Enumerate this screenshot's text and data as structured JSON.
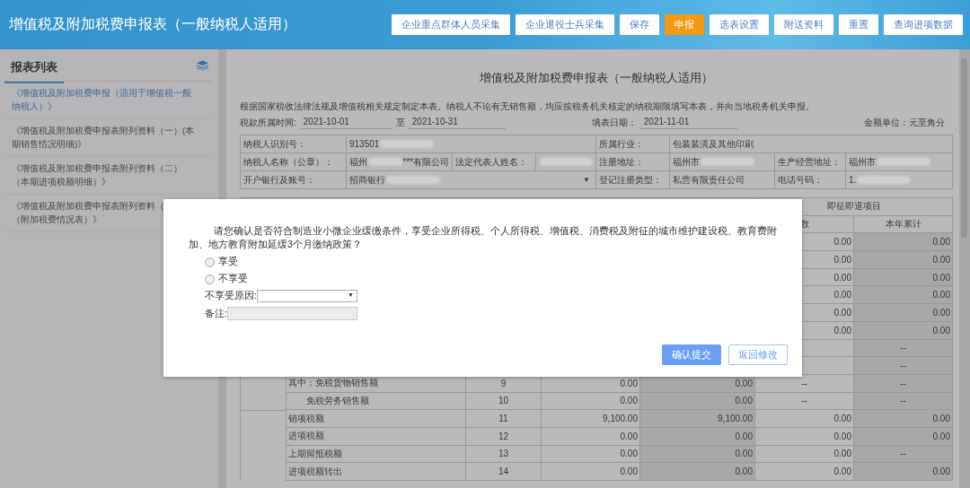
{
  "header": {
    "title": "增值税及附加税费申报表（一般纳税人适用）",
    "buttons": [
      {
        "label": "企业重点群体人员采集",
        "selected": false
      },
      {
        "label": "企业退役士兵采集",
        "selected": false
      },
      {
        "label": "保存",
        "selected": false
      },
      {
        "label": "申报",
        "selected": true
      },
      {
        "label": "选表设置",
        "selected": false
      },
      {
        "label": "附送资料",
        "selected": false
      },
      {
        "label": "重置",
        "selected": false
      },
      {
        "label": "查询进项数据",
        "selected": false
      }
    ]
  },
  "sidebar": {
    "title": "报表列表",
    "items": [
      {
        "lines": [
          "《增值税及附加税费申报（适用于增值税一般",
          "纳税人）》"
        ],
        "selected": true
      },
      {
        "lines": [
          "《增值税及附加税费申报表附列资料（一）(本",
          "期销售情况明细)》"
        ],
        "selected": false
      },
      {
        "lines": [
          "《增值税及附加税费申报表附列资料（二）",
          "（本期进项税额明细）》"
        ],
        "selected": false
      },
      {
        "lines": [
          "《增值税及附加税费申报表附列资料（",
          "（附加税费情况表）》"
        ],
        "selected": false
      }
    ]
  },
  "form": {
    "title": "增值税及附加税费申报表（一般纳税人适用）",
    "note": "根据国家税收法律法规及增值税相关规定制定本表。纳税人不论有无销售额，均应按税务机关核定的纳税期限填写本表，并向当地税务机关申报。",
    "period_label": "税款所属时间:",
    "period_start": "2021-10-01",
    "period_to": "至",
    "period_end": "2021-10-31",
    "fill_date_label": "填表日期：",
    "fill_date": "2021-11-01",
    "unit": "金额单位：元至角分",
    "info_rows": [
      [
        {
          "kind": "label",
          "text": "纳税人识别号："
        },
        {
          "kind": "value",
          "parts": [
            {
              "kind": "text",
              "text": "913501"
            },
            {
              "kind": "blur"
            }
          ]
        },
        {
          "kind": "label",
          "text": "所属行业："
        },
        {
          "kind": "value",
          "parts": [
            {
              "kind": "text",
              "text": "包装装潢及其他印刷"
            }
          ]
        }
      ],
      [
        {
          "kind": "label",
          "text": "纳税人名称（公章）："
        },
        {
          "kind": "value",
          "parts": [
            {
              "kind": "text",
              "text": "福州"
            },
            {
              "kind": "blur"
            },
            {
              "kind": "text",
              "text": "***有限公司"
            }
          ]
        },
        {
          "kind": "label",
          "text": "法定代表人姓名："
        },
        {
          "kind": "value",
          "parts": [
            {
              "kind": "blur"
            }
          ]
        },
        {
          "kind": "label",
          "text": "注册地址："
        },
        {
          "kind": "value",
          "parts": [
            {
              "kind": "text",
              "text": "福州市"
            },
            {
              "kind": "blur"
            }
          ]
        },
        {
          "kind": "label",
          "text": "生产经营地址："
        },
        {
          "kind": "value",
          "parts": [
            {
              "kind": "text",
              "text": "福州市"
            },
            {
              "kind": "blur"
            }
          ]
        }
      ],
      [
        {
          "kind": "label",
          "text": "开户银行及账号："
        },
        {
          "kind": "select",
          "parts": [
            {
              "kind": "text",
              "text": "招商银行"
            },
            {
              "kind": "blur"
            }
          ],
          "arrow": "▼"
        },
        {
          "kind": "label",
          "text": "登记注册类型："
        },
        {
          "kind": "value",
          "parts": [
            {
              "kind": "text",
              "text": "私营有限责任公司"
            }
          ]
        },
        {
          "kind": "label",
          "text": "电话号码："
        },
        {
          "kind": "value",
          "parts": [
            {
              "kind": "text",
              "text": "1."
            },
            {
              "kind": "blur"
            }
          ]
        }
      ]
    ],
    "table": {
      "group_header": "即征即退项目",
      "columns": [
        "数",
        "本年累计"
      ],
      "rows": [
        {
          "c3": "0.00",
          "c4": "0.00"
        },
        {
          "c3": "0.00",
          "c4": "0.00"
        },
        {
          "c3": "0.00",
          "c4": "0.00"
        },
        {
          "c3": "0.00",
          "c4": "0.00"
        },
        {
          "c3": "0.00",
          "c4": "0.00"
        },
        {
          "c3": "0.00",
          "c4": "0.00"
        },
        {
          "c4": "--"
        },
        {
          "c4": "--"
        },
        {
          "item": "其中：免税货物销售额",
          "kind": "main",
          "line": "9",
          "c1": "0.00",
          "c2": "0.00",
          "c3": "--",
          "c4": "--"
        },
        {
          "item": "免税劳务销售额",
          "kind": "sub",
          "line": "10",
          "c1": "0.00",
          "c2": "0.00",
          "c3": "--",
          "c4": "--"
        },
        {
          "item": "销项税额",
          "kind": "main",
          "line": "11",
          "c1": "9,100.00",
          "c2": "9,100.00",
          "c3": "0.00",
          "c4": "0.00"
        },
        {
          "item": "进项税额",
          "kind": "main",
          "line": "12",
          "c1": "0.00",
          "c2": "0.00",
          "c3": "0.00",
          "c4": "0.00"
        },
        {
          "item": "上期留抵税额",
          "kind": "main",
          "line": "13",
          "c1": "0.00",
          "c2": "0.00",
          "c3": "0.00",
          "c4": "--"
        },
        {
          "item": "进项税额转出",
          "kind": "main",
          "line": "14",
          "c1": "0.00",
          "c2": "0.00",
          "c3": "0.00",
          "c4": "0.00"
        }
      ]
    }
  },
  "dialog": {
    "question": "请您确认是否符合制造业小微企业缓缴条件，享受企业所得税、个人所得税、增值税、消费税及附征的城市维护建设税、教育费附加、地方教育附加延缓3个月缴纳政策？",
    "options": [
      {
        "label": "享受",
        "selected": false
      },
      {
        "label": "不享受",
        "selected": false
      }
    ],
    "reason_label": "不享受原因:",
    "reason_arrow": "▼",
    "remark_label": "备注:",
    "buttons": [
      {
        "label": "确认提交",
        "kind": "primary"
      },
      {
        "label": "返回修改",
        "kind": "secondary"
      }
    ]
  }
}
